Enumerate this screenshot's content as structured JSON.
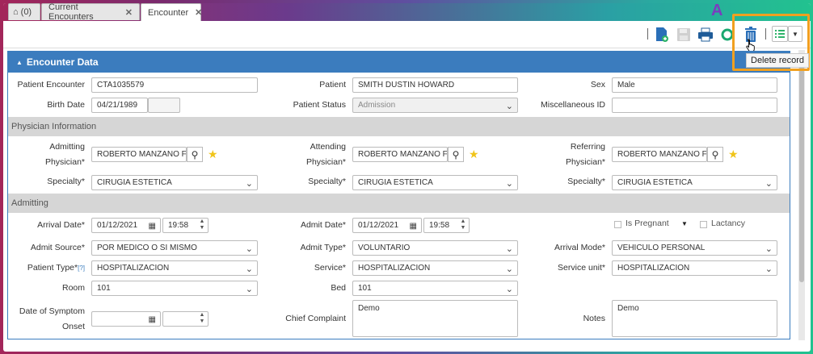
{
  "tabs": [
    {
      "label": "(0)",
      "icon": "home-icon"
    },
    {
      "label": "Current Encounters"
    },
    {
      "label": "Encounter"
    }
  ],
  "annotation_letter": "A",
  "tooltip": "Delete record",
  "panel_title": "Encounter Data",
  "fields": {
    "patient_encounter": {
      "label": "Patient Encounter",
      "value": "CTA1035579"
    },
    "patient": {
      "label": "Patient",
      "value": "SMITH DUSTIN HOWARD"
    },
    "sex": {
      "label": "Sex",
      "value": "Male"
    },
    "birth_date": {
      "label": "Birth Date",
      "value": "04/21/1989"
    },
    "patient_status": {
      "label": "Patient Status",
      "value": "Admission"
    },
    "misc_id": {
      "label": "Miscellaneous ID",
      "value": ""
    }
  },
  "physician_section": "Physician Information",
  "physicians": {
    "admitting": {
      "label1": "Admitting",
      "label2": "Physician*",
      "value": "ROBERTO MANZANO FL"
    },
    "attending": {
      "label1": "Attending",
      "label2": "Physician*",
      "value": "ROBERTO MANZANO FL"
    },
    "referring": {
      "label1": "Referring",
      "label2": "Physician*",
      "value": "ROBERTO MANZANO FL"
    },
    "specialty_label": "Specialty*",
    "specialty_value": "CIRUGIA ESTETICA"
  },
  "admitting_section": "Admitting",
  "admitting": {
    "arrival_date": {
      "label": "Arrival Date*",
      "date": "01/12/2021",
      "time": "19:58"
    },
    "admit_date": {
      "label": "Admit Date*",
      "date": "01/12/2021",
      "time": "19:58"
    },
    "is_pregnant": "Is Pregnant",
    "lactancy": "Lactancy",
    "admit_source": {
      "label": "Admit Source*",
      "value": "POR MEDICO O SI MISMO"
    },
    "admit_type": {
      "label": "Admit Type*",
      "value": "VOLUNTARIO"
    },
    "arrival_mode": {
      "label": "Arrival Mode*",
      "value": "VEHICULO PERSONAL"
    },
    "patient_type": {
      "label": "Patient Type*",
      "help": "[?]",
      "value": "HOSPITALIZACION"
    },
    "service": {
      "label": "Service*",
      "value": "HOSPITALIZACION"
    },
    "service_unit": {
      "label": "Service unit*",
      "value": "HOSPITALIZACION"
    },
    "room": {
      "label": "Room",
      "value": "101"
    },
    "bed": {
      "label": "Bed",
      "value": "101"
    },
    "symptom_onset": {
      "label1": "Date of Symptom",
      "label2": "Onset"
    },
    "chief_complaint": {
      "label": "Chief Complaint",
      "value": "Demo"
    },
    "notes": {
      "label": "Notes",
      "value": "Demo"
    }
  },
  "colors": {
    "accent": "#3b7cbe",
    "highlight": "#f0a020",
    "star": "#f0c419"
  }
}
